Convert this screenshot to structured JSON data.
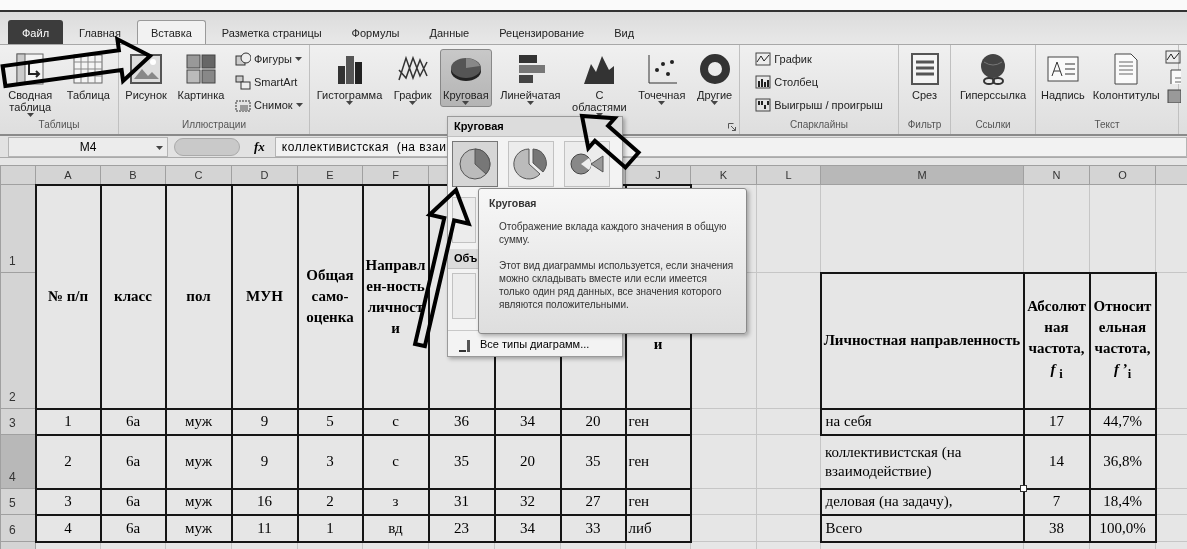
{
  "tabs": [
    {
      "label": "Файл",
      "kind": "file",
      "selected": false
    },
    {
      "label": "Главная",
      "kind": "tab",
      "selected": false
    },
    {
      "label": "Вставка",
      "kind": "tab",
      "selected": true
    },
    {
      "label": "Разметка страницы",
      "kind": "tab",
      "selected": false
    },
    {
      "label": "Формулы",
      "kind": "tab",
      "selected": false
    },
    {
      "label": "Данные",
      "kind": "tab",
      "selected": false
    },
    {
      "label": "Рецензирование",
      "kind": "tab",
      "selected": false
    },
    {
      "label": "Вид",
      "kind": "tab",
      "selected": false
    }
  ],
  "ribbon": {
    "groups": [
      {
        "label": "Таблицы",
        "launcher": false,
        "buttons": [
          {
            "label": "Сводная таблица",
            "kind": "large",
            "dropdown": true,
            "selected": false
          },
          {
            "label": "Таблица",
            "kind": "large",
            "dropdown": false,
            "selected": false
          }
        ]
      },
      {
        "label": "Иллюстрации",
        "launcher": false,
        "buttons": [
          {
            "label": "Рисунок",
            "kind": "large",
            "dropdown": false,
            "selected": false
          },
          {
            "label": "Картинка",
            "kind": "large",
            "dropdown": false,
            "selected": false
          },
          {
            "label": "Фигуры",
            "kind": "small",
            "dropdown": true,
            "selected": false
          },
          {
            "label": "SmartArt",
            "kind": "small",
            "dropdown": false,
            "selected": false
          },
          {
            "label": "Снимок",
            "kind": "small",
            "dropdown": true,
            "selected": false
          }
        ]
      },
      {
        "launcher": true,
        "buttons": [
          {
            "label": "Гистограмма",
            "kind": "large",
            "dropdown": true,
            "selected": false
          },
          {
            "label": "График",
            "kind": "large",
            "dropdown": true,
            "selected": false
          },
          {
            "label": "Круговая",
            "kind": "large",
            "dropdown": true,
            "selected": true
          },
          {
            "label": "Линейчатая",
            "kind": "large",
            "dropdown": true,
            "selected": false
          },
          {
            "label": "С областями",
            "kind": "large",
            "dropdown": true,
            "selected": false
          },
          {
            "label": "Точечная",
            "kind": "large",
            "dropdown": true,
            "selected": false
          },
          {
            "label": "Другие",
            "kind": "large",
            "dropdown": true,
            "selected": false
          }
        ]
      },
      {
        "label": "Спарклайны",
        "launcher": false,
        "buttons": [
          {
            "label": "График",
            "kind": "small",
            "dropdown": false,
            "selected": false
          },
          {
            "label": "Столбец",
            "kind": "small",
            "dropdown": false,
            "selected": false
          },
          {
            "label": "Выигрыш / проигрыш",
            "kind": "small",
            "dropdown": false,
            "selected": false
          }
        ]
      },
      {
        "label": "Фильтр",
        "launcher": false,
        "buttons": [
          {
            "label": "Срез",
            "kind": "large",
            "dropdown": false,
            "selected": false
          }
        ]
      },
      {
        "label": "Ссылки",
        "launcher": false,
        "buttons": [
          {
            "label": "Гиперссылка",
            "kind": "large",
            "dropdown": false,
            "selected": false
          }
        ]
      },
      {
        "label": "Текст",
        "launcher": false,
        "buttons": [
          {
            "label": "Надпись",
            "kind": "large",
            "dropdown": false,
            "selected": false
          },
          {
            "label": "Колонтитулы",
            "kind": "large",
            "dropdown": false,
            "selected": false
          }
        ]
      }
    ]
  },
  "formula_bar": {
    "name_box": "M4",
    "fx": "fx",
    "value": "коллективистская  (на взаи"
  },
  "sheet": {
    "columns": [
      {
        "label": "A",
        "selected": false
      },
      {
        "label": "B",
        "selected": false
      },
      {
        "label": "C",
        "selected": false
      },
      {
        "label": "D",
        "selected": false
      },
      {
        "label": "E",
        "selected": false
      },
      {
        "label": "F",
        "selected": false
      },
      {},
      {},
      {},
      {
        "label": "J",
        "selected": false
      },
      {
        "label": "K",
        "selected": false
      },
      {
        "label": "L",
        "selected": false
      },
      {
        "label": "M",
        "selected": true
      },
      {
        "label": "N",
        "selected": false
      },
      {
        "label": "O",
        "selected": false
      }
    ],
    "rows": [
      {
        "label": "1",
        "selected": false
      },
      {
        "label": "2",
        "selected": false
      },
      {
        "label": "3",
        "selected": false
      },
      {
        "label": "4",
        "selected": true
      },
      {
        "label": "5",
        "selected": false
      },
      {
        "label": "6",
        "selected": false
      }
    ],
    "main_table": {
      "headers": [
        "№ п/п",
        "класс",
        "пол",
        "МУН",
        "Общая само-оценка",
        "Направлен-ность личности"
      ],
      "last_header": "и",
      "rows": [
        [
          "1",
          "6а",
          "муж",
          "9",
          "5",
          "с",
          "36",
          "34",
          "20",
          "ген"
        ],
        [
          "2",
          "6а",
          "муж",
          "9",
          "3",
          "с",
          "35",
          "20",
          "35",
          "ген"
        ],
        [
          "3",
          "6а",
          "муж",
          "16",
          "2",
          "з",
          "31",
          "32",
          "27",
          "ген"
        ],
        [
          "4",
          "6а",
          "муж",
          "11",
          "1",
          "вд",
          "23",
          "34",
          "33",
          "либ"
        ]
      ]
    },
    "freq_table": {
      "headers": [
        "Личностная направленность",
        "Абсолютная частота, *f* $_{i}$",
        "Относительная частота, *f* ’$_{i}$"
      ],
      "rows": [
        {
          "cells": [
            "на себя",
            "17",
            "44,7%"
          ],
          "selected": false
        },
        {
          "cells": [
            "коллективистская  (на взаимодействие)",
            "14",
            "36,8%"
          ],
          "selected": true
        },
        {
          "cells": [
            "деловая  (на задачу),",
            "7",
            "18,4%"
          ],
          "selected": false
        },
        {
          "cells": [
            "Всего",
            "38",
            "100,0%"
          ],
          "selected": false
        }
      ]
    }
  },
  "chart_menu": {
    "title": "Круговая",
    "thumbnails": [
      {
        "selected": true
      },
      {
        "selected": false
      },
      {
        "selected": false
      }
    ],
    "section": "Объ",
    "footer": "Все типы диаграмм..."
  },
  "tooltip": {
    "title": "Круговая",
    "paragraphs": [
      "Отображение вклада каждого значения в общую сумму.",
      "Этот вид диаграммы используется, если значения можно складывать вместе или если имеется только один ряд данных, все значения которого являются положительными."
    ]
  }
}
